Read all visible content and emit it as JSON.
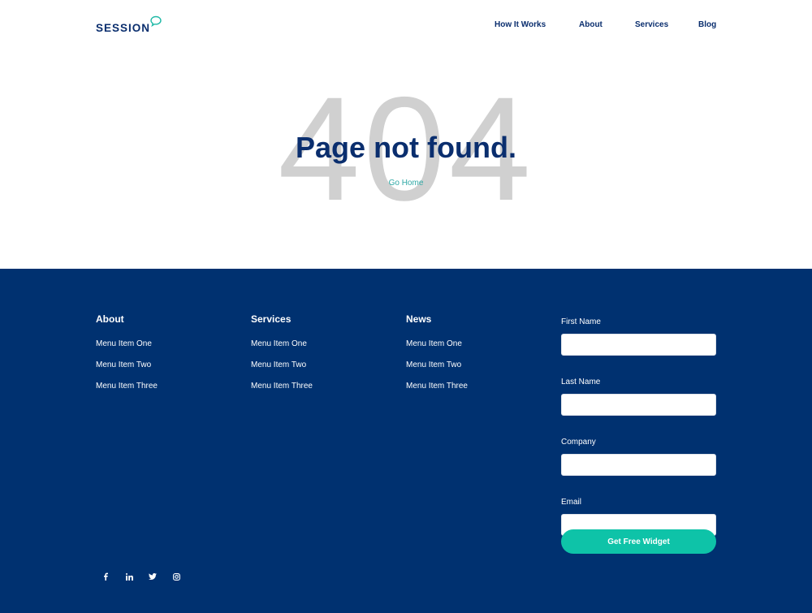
{
  "header": {
    "logo_text": "SESSION",
    "nav": [
      {
        "label": "How It Works"
      },
      {
        "label": "About"
      },
      {
        "label": "Services"
      },
      {
        "label": "Blog"
      }
    ]
  },
  "hero": {
    "code": "404",
    "title": "Page not found.",
    "home_link": "Go Home"
  },
  "footer": {
    "columns": [
      {
        "title": "About",
        "items": [
          "Menu Item One",
          "Menu Item Two",
          "Menu Item Three"
        ]
      },
      {
        "title": "Services",
        "items": [
          "Menu Item One",
          "Menu Item Two",
          "Menu Item Three"
        ]
      },
      {
        "title": "News",
        "items": [
          "Menu Item One",
          "Menu Item Two",
          "Menu Item Three"
        ]
      }
    ],
    "form": {
      "fields": [
        {
          "label": "First Name",
          "value": ""
        },
        {
          "label": "Last Name",
          "value": ""
        },
        {
          "label": "Company",
          "value": ""
        },
        {
          "label": "Email",
          "value": ""
        }
      ],
      "submit_label": "Get Free Widget"
    },
    "socials": [
      "facebook-icon",
      "linkedin-icon",
      "twitter-icon",
      "instagram-icon"
    ]
  },
  "colors": {
    "brand_navy": "#0a2e6e",
    "footer_bg": "#003170",
    "accent_teal": "#0ec3a8",
    "link_teal": "#2fa8a5",
    "code_gray": "#d0d0d0"
  }
}
